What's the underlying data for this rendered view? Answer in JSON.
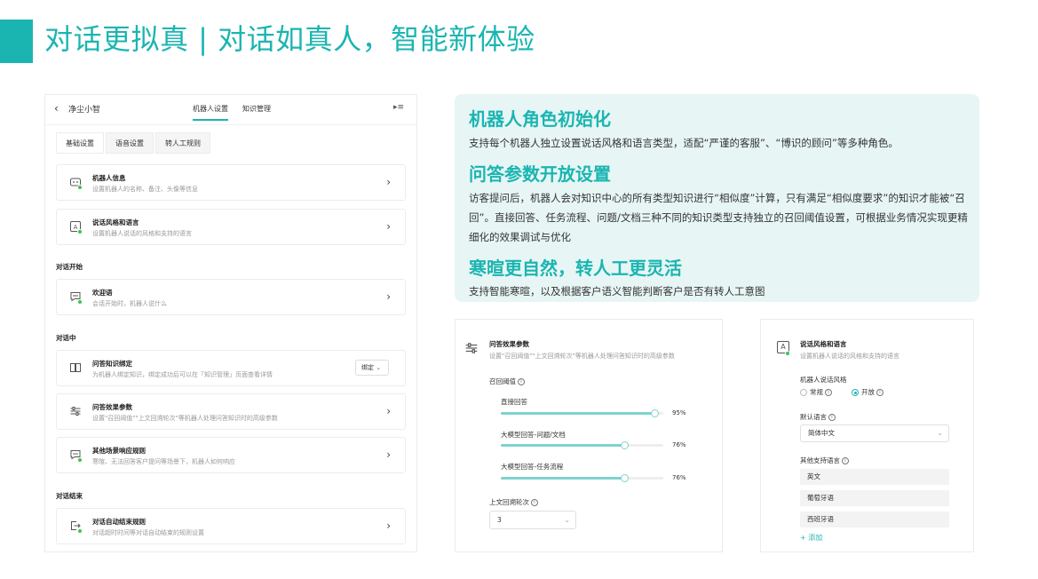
{
  "header": {
    "title": "对话更拟真 | 对话如真人，智能新体验",
    "accent_color": "#1bb5b1"
  },
  "left_panel": {
    "app_name": "净尘小智",
    "top_tabs": [
      {
        "label": "机器人设置",
        "active": true
      },
      {
        "label": "知识管理",
        "active": false
      }
    ],
    "sub_tabs": [
      {
        "label": "基础设置",
        "active": true
      },
      {
        "label": "语音设置",
        "active": false
      },
      {
        "label": "转人工规则",
        "active": false
      }
    ],
    "cards": {
      "robot_info": {
        "title": "机器人信息",
        "desc": "设置机器人的名称、备注、头像等信息",
        "icon": "robot-icon"
      },
      "style_lang": {
        "title": "说话风格和语言",
        "desc": "设置机器人说话的风格和支持的语言",
        "icon": "language-icon"
      },
      "welcome": {
        "title": "欢迎语",
        "desc": "会话开始时，机器人说什么",
        "icon": "chat-bubble-icon"
      },
      "kb_bind": {
        "title": "问答知识绑定",
        "desc": "为机器人绑定知识，绑定成功后可以在「知识管理」页面查看详情",
        "icon": "book-icon",
        "action_label": "绑定"
      },
      "qa_params": {
        "title": "问答效果参数",
        "desc": "设置\"召回阈值\"\"上文回溯轮次\"等机器人处理问答知识时的高级参数",
        "icon": "sliders-icon"
      },
      "other_scene": {
        "title": "其他场景响应规则",
        "desc": "寒暄、无法回答客户提问等场景下，机器人如何响应",
        "icon": "message-dots-icon"
      },
      "auto_end": {
        "title": "对话自动结束规则",
        "desc": "对话超时时间等对话自动结束的规则设置",
        "icon": "exit-icon"
      }
    },
    "sections": {
      "start": "对话开始",
      "middle": "对话中",
      "end": "对话结束"
    }
  },
  "feature_box": {
    "items": [
      {
        "heading": "机器人角色初始化",
        "text": "支持每个机器人独立设置说话风格和语言类型，适配“严谨的客服”、“博识的顾问”等多种角色。"
      },
      {
        "heading": "问答参数开放设置",
        "text": "访客提问后，机器人会对知识中心的所有类型知识进行“相似度”计算，只有满足“相似度要求”的知识才能被“召回”。直接回答、任务流程、问题/文档三种不同的知识类型支持独立的召回阈值设置，可根据业务情况实现更精细化的效果调试与优化"
      },
      {
        "heading": "寒暄更自然，转人工更灵活",
        "text": "支持智能寒暄，以及根据客户语义智能判断客户是否有转人工意图"
      }
    ]
  },
  "qa_panel": {
    "title": "问答效果参数",
    "desc": "设置\"召回阈值\"\"上文回溯轮次\"等机器人处理问答知识时的高级参数",
    "threshold_label": "召回阈值",
    "sliders": [
      {
        "label": "直接回答",
        "value": 0.95,
        "display": "95%"
      },
      {
        "label": "大模型回答-问题/文档",
        "value": 0.76,
        "display": "76%"
      },
      {
        "label": "大模型回答-任务流程",
        "value": 0.76,
        "display": "76%"
      }
    ],
    "rounds_label": "上文回溯轮次",
    "rounds_value": "3"
  },
  "style_panel": {
    "title": "说话风格和语言",
    "desc": "设置机器人说话的风格和支持的语言",
    "style_label": "机器人说话风格",
    "options": [
      {
        "label": "常规",
        "selected": false
      },
      {
        "label": "开放",
        "selected": true
      }
    ],
    "default_lang_label": "默认语言",
    "default_lang": "简体中文",
    "other_lang_label": "其他支持语言",
    "other_langs": [
      "英文",
      "葡萄牙语",
      "西班牙语"
    ],
    "add_label": "+ 添加"
  }
}
